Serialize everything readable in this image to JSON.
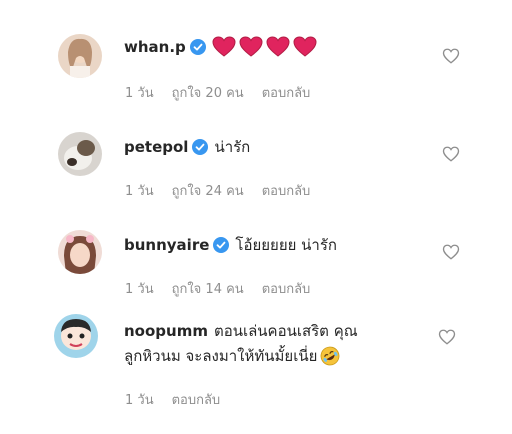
{
  "comments": [
    {
      "username": "whan.p",
      "verified": true,
      "text": "",
      "emoji": [
        "red-heart",
        "red-heart",
        "red-heart",
        "red-heart"
      ],
      "time": "1 วัน",
      "likes": "ถูกใจ 20 คน",
      "reply": "ตอบกลับ"
    },
    {
      "username": "petepol",
      "verified": true,
      "text": "น่ารัก",
      "time": "1 วัน",
      "likes": "ถูกใจ 24 คน",
      "reply": "ตอบกลับ"
    },
    {
      "username": "bunnyaire",
      "verified": true,
      "text": "โอ้ยยยยย น่ารัก",
      "time": "1 วัน",
      "likes": "ถูกใจ 14 คน",
      "reply": "ตอบกลับ"
    },
    {
      "username": "noopumm",
      "verified": false,
      "text": "ตอนเล่นคอนเสริต คุณ",
      "text_line2": "ลูกหิวนม จะลงมาให้ทันมั้ยเนี่ย",
      "emoji_end": "rolling-laughing-face",
      "time": "1 วัน",
      "reply": "ตอบกลับ"
    }
  ],
  "colors": {
    "verified_blue": "#3897f0",
    "heart_red": "#e0245e",
    "meta_gray": "#8e8e8e",
    "text": "#262626"
  },
  "icons": {
    "like": "heart-outline-icon",
    "verified": "verified-badge-icon"
  }
}
